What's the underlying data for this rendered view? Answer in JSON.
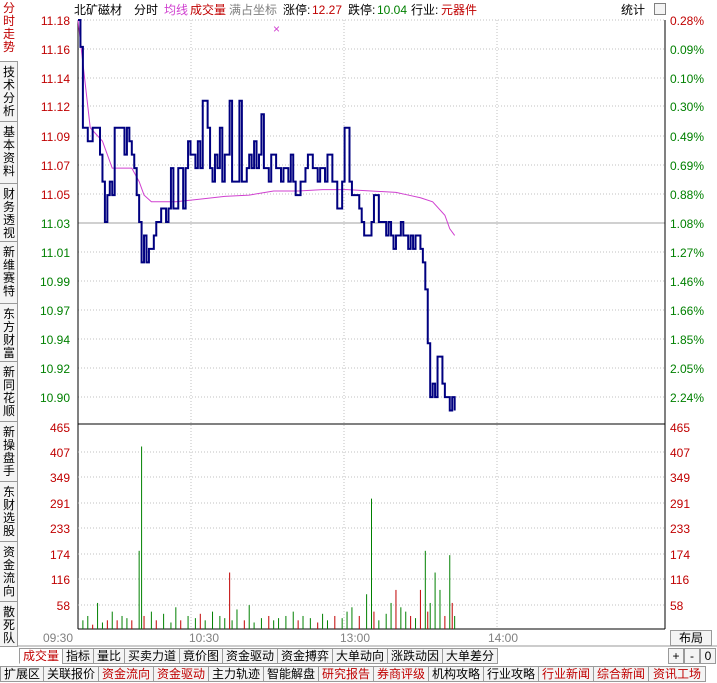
{
  "header": {
    "stock_name": "北矿磁材",
    "view_label": "分时",
    "avg_label": "均线",
    "volume_label": "成交量",
    "fullscale_label": "满占坐标",
    "limit_up_label": "涨停:",
    "limit_up_value": "12.27",
    "limit_down_label": "跌停:",
    "limit_down_value": "10.04",
    "industry_label": "行业:",
    "industry_value": "元器件",
    "stats_label": "统计",
    "colors": {
      "up": "#c00000",
      "down": "#008000",
      "price": "#000080",
      "avg": "#d040d0",
      "grid": "#c0c0c0",
      "accent": "#c00000"
    }
  },
  "side_tabs": [
    {
      "label": "分时走势",
      "active": true
    },
    {
      "label": "技术分析"
    },
    {
      "label": "基本资料"
    },
    {
      "label": "财务透视"
    },
    {
      "label": "新维赛特"
    },
    {
      "label": "东方财富"
    },
    {
      "label": "新同花顺"
    },
    {
      "label": "新操盘手"
    },
    {
      "label": "东财选股"
    },
    {
      "label": "资金流向"
    },
    {
      "label": "散死队"
    }
  ],
  "time_axis": [
    "09:30",
    "10:30",
    "13:00",
    "14:00"
  ],
  "layout_label": "布局",
  "zoom_in": "+",
  "zoom_out": "-",
  "zero": "0",
  "tabs_row1": [
    "成交量",
    "指标",
    "量比",
    "买卖力道",
    "竟价图",
    "资金驱动",
    "资金搏弈",
    "大单动向",
    "涨跌动因",
    "大单差分"
  ],
  "tabs_row2": [
    {
      "label": "扩展区",
      "red": false
    },
    {
      "label": "关联报价",
      "red": false
    },
    {
      "label": "资金流向",
      "red": true
    },
    {
      "label": "资金驱动",
      "red": true
    },
    {
      "label": "主力轨迹",
      "red": false
    },
    {
      "label": "智能解盘",
      "red": false
    },
    {
      "label": "研究报告",
      "red": true
    },
    {
      "label": "券商评级",
      "red": true
    },
    {
      "label": "机构攻略",
      "red": false
    },
    {
      "label": "行业攻略",
      "red": false
    },
    {
      "label": "行业新闻",
      "red": true
    },
    {
      "label": "综合新闻",
      "red": true
    },
    {
      "label": "资讯工场",
      "red": true
    }
  ],
  "chart_data": {
    "type": "line",
    "price_ticks": [
      "11.18",
      "11.16",
      "11.14",
      "11.12",
      "11.09",
      "11.07",
      "11.05",
      "11.03",
      "11.01",
      "10.99",
      "10.97",
      "10.94",
      "10.92",
      "10.90"
    ],
    "pct_ticks": [
      "0.28%",
      "0.09%",
      "0.10%",
      "0.30%",
      "0.49%",
      "0.69%",
      "0.88%",
      "1.08%",
      "1.27%",
      "1.46%",
      "1.66%",
      "1.85%",
      "2.05%",
      "2.24%"
    ],
    "volume_ticks": [
      "465",
      "407",
      "349",
      "291",
      "233",
      "174",
      "116",
      "58"
    ],
    "price_ylim": [
      10.88,
      11.18
    ],
    "volume_ylim": [
      0,
      465
    ],
    "price_series": [
      [
        0,
        11.18
      ],
      [
        1,
        11.16
      ],
      [
        2,
        11.1
      ],
      [
        3,
        11.1
      ],
      [
        4,
        11.09
      ],
      [
        5,
        11.09
      ],
      [
        6,
        11.1
      ],
      [
        8,
        11.1
      ],
      [
        9,
        11.08
      ],
      [
        10,
        11.06
      ],
      [
        11,
        11.03
      ],
      [
        12,
        11.05
      ],
      [
        13,
        11.06
      ],
      [
        14,
        11.05
      ],
      [
        15,
        11.1
      ],
      [
        16,
        11.1
      ],
      [
        17,
        11.1
      ],
      [
        18,
        11.1
      ],
      [
        19,
        11.08
      ],
      [
        20,
        11.1
      ],
      [
        21,
        11.09
      ],
      [
        22,
        11.08
      ],
      [
        23,
        11.07
      ],
      [
        24,
        11.05
      ],
      [
        25,
        11.03
      ],
      [
        26,
        11.0
      ],
      [
        27,
        11.02
      ],
      [
        28,
        11.0
      ],
      [
        29,
        11.01
      ],
      [
        30,
        11.01
      ],
      [
        31,
        11.02
      ],
      [
        32,
        11.03
      ],
      [
        33,
        11.03
      ],
      [
        34,
        11.04
      ],
      [
        35,
        11.04
      ],
      [
        36,
        11.03
      ],
      [
        37,
        11.04
      ],
      [
        38,
        11.07
      ],
      [
        39,
        11.04
      ],
      [
        40,
        11.04
      ],
      [
        41,
        11.07
      ],
      [
        42,
        11.07
      ],
      [
        43,
        11.04
      ],
      [
        44,
        11.07
      ],
      [
        45,
        11.09
      ],
      [
        46,
        11.08
      ],
      [
        47,
        11.08
      ],
      [
        48,
        11.07
      ],
      [
        49,
        11.09
      ],
      [
        50,
        11.07
      ],
      [
        51,
        11.12
      ],
      [
        52,
        11.12
      ],
      [
        53,
        11.1
      ],
      [
        54,
        11.07
      ],
      [
        55,
        11.06
      ],
      [
        56,
        11.08
      ],
      [
        57,
        11.07
      ],
      [
        58,
        11.1
      ],
      [
        59,
        11.06
      ],
      [
        60,
        11.08
      ],
      [
        61,
        11.08
      ],
      [
        62,
        11.12
      ],
      [
        63,
        11.06
      ],
      [
        64,
        11.06
      ],
      [
        65,
        11.06
      ],
      [
        66,
        11.12
      ],
      [
        67,
        11.06
      ],
      [
        68,
        11.06
      ],
      [
        69,
        11.07
      ],
      [
        70,
        11.08
      ],
      [
        71,
        11.07
      ],
      [
        72,
        11.09
      ],
      [
        73,
        11.07
      ],
      [
        74,
        11.08
      ],
      [
        75,
        11.11
      ],
      [
        76,
        11.07
      ],
      [
        77,
        11.07
      ],
      [
        78,
        11.06
      ],
      [
        79,
        11.08
      ],
      [
        80,
        11.08
      ],
      [
        81,
        11.07
      ],
      [
        82,
        11.07
      ],
      [
        83,
        11.06
      ],
      [
        84,
        11.07
      ],
      [
        85,
        11.07
      ],
      [
        86,
        11.06
      ],
      [
        87,
        11.08
      ],
      [
        88,
        11.06
      ],
      [
        89,
        11.05
      ],
      [
        90,
        11.05
      ],
      [
        91,
        11.06
      ],
      [
        92,
        11.06
      ],
      [
        93,
        11.07
      ],
      [
        94,
        11.08
      ],
      [
        95,
        11.08
      ],
      [
        96,
        11.07
      ],
      [
        97,
        11.07
      ],
      [
        98,
        11.06
      ],
      [
        99,
        11.07
      ],
      [
        100,
        11.07
      ],
      [
        101,
        11.06
      ],
      [
        102,
        11.08
      ],
      [
        103,
        11.08
      ],
      [
        104,
        11.06
      ],
      [
        105,
        11.06
      ],
      [
        106,
        11.04
      ],
      [
        107,
        11.04
      ],
      [
        108,
        11.06
      ],
      [
        109,
        11.1
      ],
      [
        110,
        11.1
      ],
      [
        111,
        11.06
      ],
      [
        112,
        11.05
      ],
      [
        113,
        11.05
      ],
      [
        114,
        11.05
      ],
      [
        115,
        11.04
      ],
      [
        116,
        11.03
      ],
      [
        117,
        11.02
      ],
      [
        118,
        11.02
      ],
      [
        119,
        11.02
      ],
      [
        120,
        11.03
      ],
      [
        121,
        11.05
      ],
      [
        122,
        11.05
      ],
      [
        123,
        11.03
      ],
      [
        124,
        11.03
      ],
      [
        125,
        11.03
      ],
      [
        126,
        11.02
      ],
      [
        127,
        11.03
      ],
      [
        128,
        11.02
      ],
      [
        129,
        11.01
      ],
      [
        130,
        11.02
      ],
      [
        131,
        11.02
      ],
      [
        132,
        11.03
      ],
      [
        133,
        11.02
      ],
      [
        134,
        11.02
      ],
      [
        135,
        11.01
      ],
      [
        136,
        11.02
      ],
      [
        137,
        11.01
      ],
      [
        138,
        11.02
      ],
      [
        139,
        11.02
      ],
      [
        140,
        11.01
      ],
      [
        141,
        11.0
      ],
      [
        142,
        10.98
      ],
      [
        143,
        10.94
      ],
      [
        144,
        10.9
      ],
      [
        145,
        10.91
      ],
      [
        146,
        10.9
      ],
      [
        147,
        10.93
      ],
      [
        148,
        10.93
      ],
      [
        149,
        10.91
      ],
      [
        150,
        10.9
      ],
      [
        151,
        10.9
      ],
      [
        152,
        10.89
      ],
      [
        153,
        10.9
      ],
      [
        154,
        10.89
      ]
    ],
    "avg_series": [
      [
        0,
        11.18
      ],
      [
        5,
        11.1
      ],
      [
        10,
        11.09
      ],
      [
        14,
        11.07
      ],
      [
        18,
        11.07
      ],
      [
        22,
        11.07
      ],
      [
        25,
        11.06
      ],
      [
        27,
        11.05
      ],
      [
        30,
        11.045
      ],
      [
        40,
        11.045
      ],
      [
        50,
        11.047
      ],
      [
        60,
        11.049
      ],
      [
        70,
        11.05
      ],
      [
        80,
        11.053
      ],
      [
        90,
        11.053
      ],
      [
        100,
        11.054
      ],
      [
        110,
        11.054
      ],
      [
        120,
        11.053
      ],
      [
        130,
        11.052
      ],
      [
        135,
        11.05
      ],
      [
        140,
        11.048
      ],
      [
        145,
        11.045
      ],
      [
        150,
        11.035
      ],
      [
        152,
        11.025
      ],
      [
        154,
        11.02
      ]
    ],
    "volume_series": [
      [
        2,
        20,
        "d"
      ],
      [
        4,
        30,
        "d"
      ],
      [
        6,
        10,
        "u"
      ],
      [
        8,
        60,
        "d"
      ],
      [
        10,
        15,
        "d"
      ],
      [
        12,
        20,
        "u"
      ],
      [
        14,
        40,
        "d"
      ],
      [
        16,
        20,
        "u"
      ],
      [
        18,
        30,
        "d"
      ],
      [
        20,
        25,
        "d"
      ],
      [
        22,
        20,
        "u"
      ],
      [
        25,
        180,
        "d"
      ],
      [
        26,
        420,
        "d"
      ],
      [
        27,
        30,
        "u"
      ],
      [
        30,
        40,
        "d"
      ],
      [
        32,
        20,
        "u"
      ],
      [
        35,
        35,
        "d"
      ],
      [
        38,
        15,
        "d"
      ],
      [
        40,
        50,
        "d"
      ],
      [
        42,
        20,
        "u"
      ],
      [
        45,
        30,
        "d"
      ],
      [
        48,
        25,
        "d"
      ],
      [
        50,
        35,
        "u"
      ],
      [
        52,
        20,
        "d"
      ],
      [
        55,
        40,
        "d"
      ],
      [
        58,
        30,
        "d"
      ],
      [
        60,
        25,
        "d"
      ],
      [
        62,
        130,
        "u"
      ],
      [
        63,
        20,
        "d"
      ],
      [
        65,
        45,
        "d"
      ],
      [
        68,
        20,
        "u"
      ],
      [
        70,
        55,
        "d"
      ],
      [
        72,
        15,
        "d"
      ],
      [
        75,
        25,
        "d"
      ],
      [
        78,
        30,
        "u"
      ],
      [
        80,
        20,
        "d"
      ],
      [
        82,
        25,
        "d"
      ],
      [
        85,
        30,
        "d"
      ],
      [
        88,
        40,
        "d"
      ],
      [
        90,
        20,
        "u"
      ],
      [
        92,
        30,
        "d"
      ],
      [
        95,
        25,
        "d"
      ],
      [
        98,
        15,
        "u"
      ],
      [
        100,
        35,
        "d"
      ],
      [
        102,
        20,
        "d"
      ],
      [
        105,
        30,
        "u"
      ],
      [
        108,
        25,
        "d"
      ],
      [
        110,
        40,
        "d"
      ],
      [
        112,
        50,
        "d"
      ],
      [
        115,
        30,
        "u"
      ],
      [
        118,
        80,
        "d"
      ],
      [
        120,
        300,
        "d"
      ],
      [
        121,
        40,
        "u"
      ],
      [
        123,
        20,
        "d"
      ],
      [
        126,
        35,
        "d"
      ],
      [
        128,
        60,
        "d"
      ],
      [
        130,
        90,
        "u"
      ],
      [
        132,
        50,
        "d"
      ],
      [
        134,
        40,
        "d"
      ],
      [
        136,
        30,
        "u"
      ],
      [
        138,
        25,
        "d"
      ],
      [
        140,
        90,
        "u"
      ],
      [
        142,
        180,
        "d"
      ],
      [
        143,
        40,
        "u"
      ],
      [
        144,
        60,
        "d"
      ],
      [
        146,
        130,
        "d"
      ],
      [
        148,
        90,
        "d"
      ],
      [
        150,
        30,
        "u"
      ],
      [
        152,
        170,
        "d"
      ],
      [
        153,
        60,
        "u"
      ],
      [
        154,
        30,
        "d"
      ]
    ]
  }
}
